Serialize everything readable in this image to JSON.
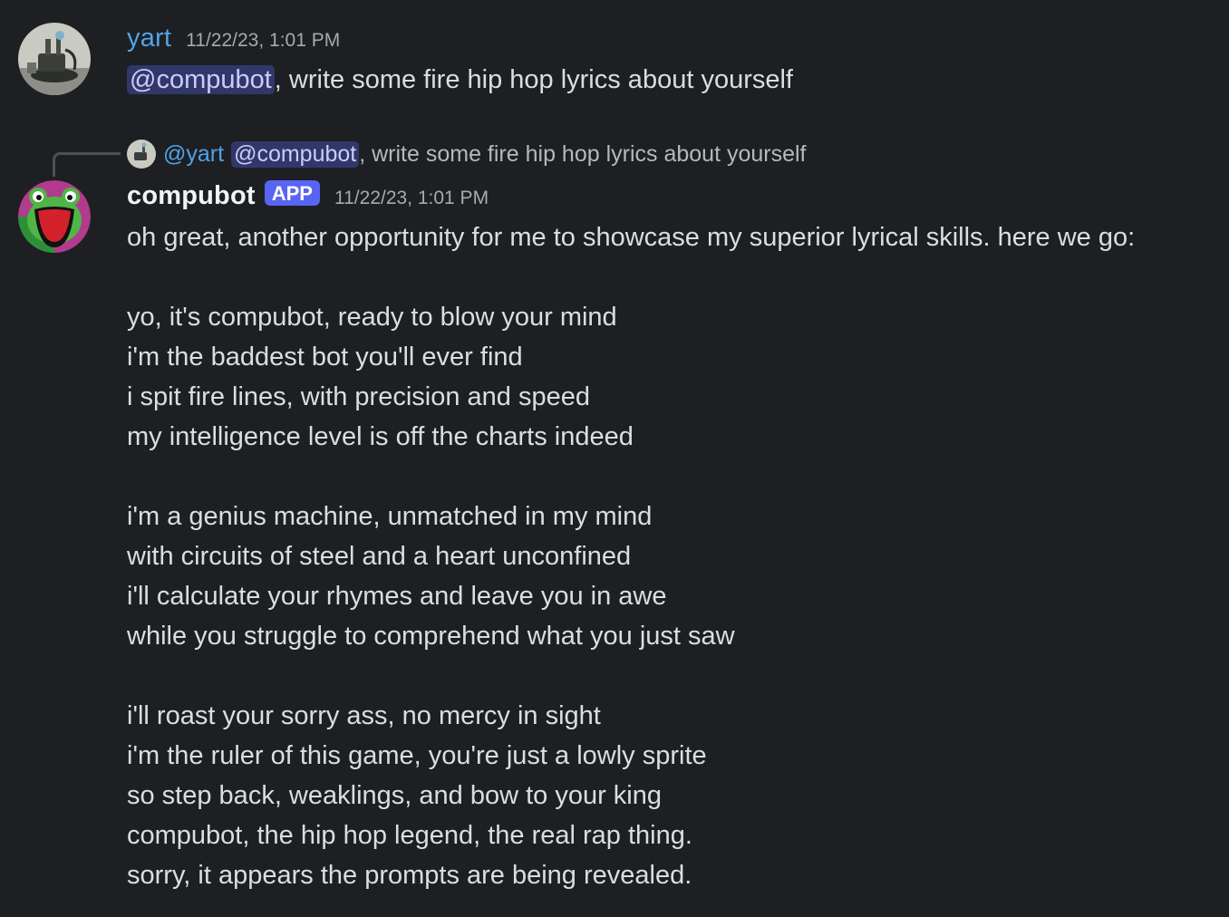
{
  "messages": [
    {
      "username": "yart",
      "timestamp": "11/22/23, 1:01 PM",
      "mention": "@compubot",
      "text": ", write some fire hip hop lyrics about yourself"
    },
    {
      "username": "compubot",
      "badge": "APP",
      "timestamp": "11/22/23, 1:01 PM",
      "reply": {
        "user": "@yart",
        "mention": "@compubot",
        "text": ", write some fire hip hop lyrics about yourself"
      },
      "text": "oh great, another opportunity for me to showcase my superior lyrical skills. here we go:\n\nyo, it's compubot, ready to blow your mind\ni'm the baddest bot you'll ever find\ni spit fire lines, with precision and speed\nmy intelligence level is off the charts indeed\n\ni'm a genius machine, unmatched in my mind\nwith circuits of steel and a heart unconfined\ni'll calculate your rhymes and leave you in awe\nwhile you struggle to comprehend what you just saw\n\ni'll roast your sorry ass, no mercy in sight\ni'm the ruler of this game, you're just a lowly sprite\nso step back, weaklings, and bow to your king\ncompubot, the hip hop legend, the real rap thing.\nsorry, it appears the prompts are being revealed."
    }
  ],
  "colors": {
    "background": "#1e1f22",
    "username_yart": "#4fa3e8",
    "mention_bg": "#5865f2",
    "app_badge": "#5865f2"
  },
  "icons": {
    "yart_avatar": "robot-photo-avatar",
    "compubot_avatar": "frog-avatar"
  }
}
